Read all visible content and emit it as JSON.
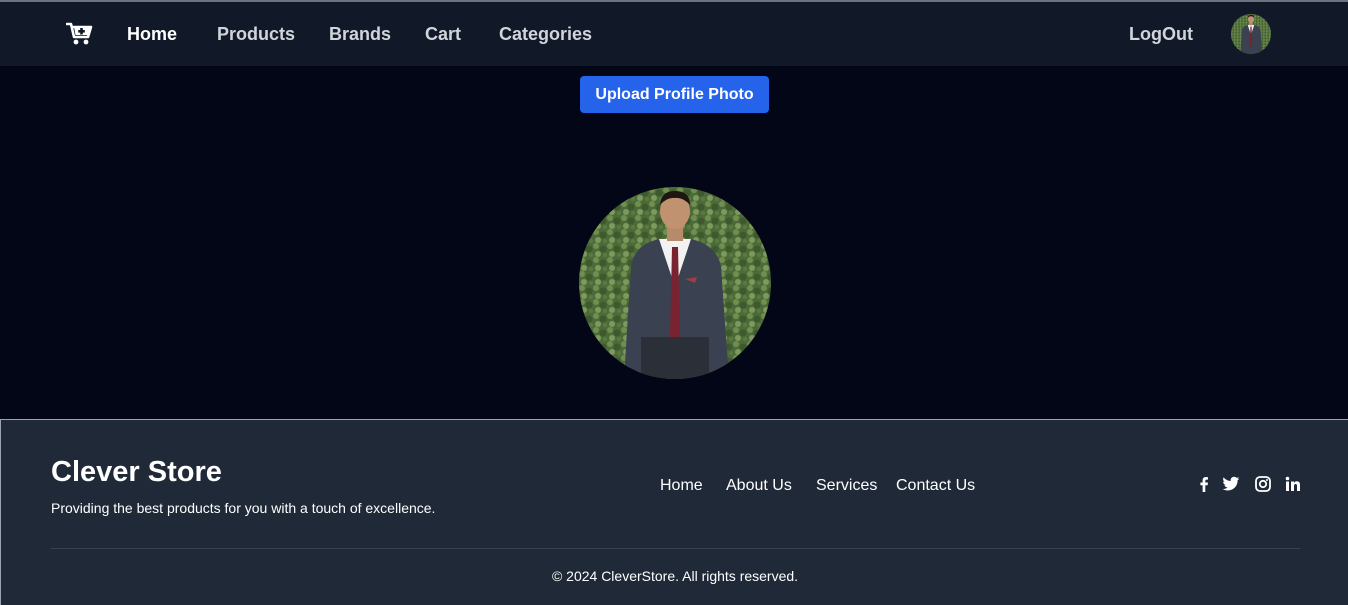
{
  "navbar": {
    "logo_icon": "cart-plus-icon",
    "links": [
      {
        "label": "Home",
        "active": true
      },
      {
        "label": "Products",
        "active": false
      },
      {
        "label": "Brands",
        "active": false
      },
      {
        "label": "Cart",
        "active": false
      },
      {
        "label": "Categories",
        "active": false
      }
    ],
    "logout_label": "LogOut",
    "avatar_icon": "user-avatar"
  },
  "profile": {
    "upload_button_label": "Upload Profile Photo",
    "photo_icon": "profile-photo"
  },
  "footer": {
    "brand": "Clever Store",
    "tagline": "Providing the best products for you with a touch of excellence.",
    "links": [
      "Home",
      "About Us",
      "Services",
      "Contact Us"
    ],
    "social_icons": [
      "facebook-icon",
      "twitter-icon",
      "instagram-icon",
      "linkedin-icon"
    ],
    "copyright": "© 2024 CleverStore. All rights reserved."
  },
  "colors": {
    "page_bg": "#020617",
    "navbar_bg": "#111827",
    "footer_bg": "#1f2937",
    "accent": "#2563eb",
    "text": "#ffffff"
  }
}
